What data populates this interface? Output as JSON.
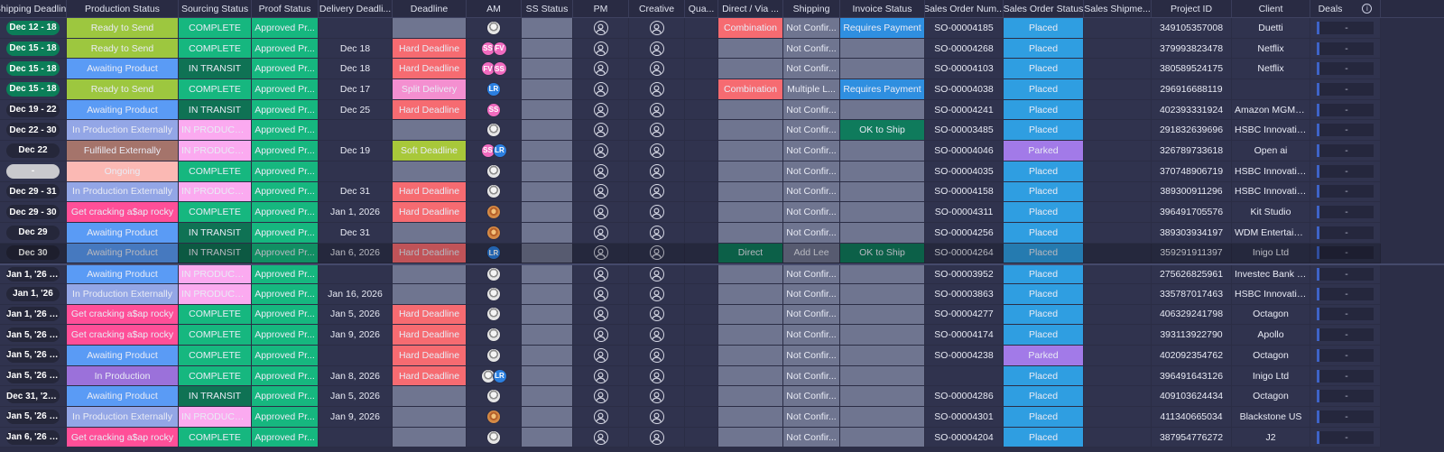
{
  "columns": [
    {
      "key": "ship",
      "label": "Shipping Deadline",
      "w": 74
    },
    {
      "key": "prod",
      "label": "Production Status",
      "w": 124
    },
    {
      "key": "src",
      "label": "Sourcing Status",
      "w": 81
    },
    {
      "key": "proof",
      "label": "Proof Status",
      "w": 74
    },
    {
      "key": "deliv",
      "label": "Delivery Deadli...",
      "w": 82
    },
    {
      "key": "dead",
      "label": "Deadline",
      "w": 82
    },
    {
      "key": "am",
      "label": "AM",
      "w": 61
    },
    {
      "key": "ss",
      "label": "SS Status",
      "w": 57
    },
    {
      "key": "pm",
      "label": "PM",
      "w": 62
    },
    {
      "key": "creative",
      "label": "Creative",
      "w": 62
    },
    {
      "key": "qua",
      "label": "Qua...",
      "w": 37
    },
    {
      "key": "direct",
      "label": "Direct / Via ...",
      "w": 72
    },
    {
      "key": "shipping",
      "label": "Shipping",
      "w": 63
    },
    {
      "key": "invoice",
      "label": "Invoice Status",
      "w": 94
    },
    {
      "key": "so",
      "label": "Sales Order Num...",
      "w": 87
    },
    {
      "key": "sos",
      "label": "Sales Order Status",
      "w": 89
    },
    {
      "key": "sship",
      "label": "Sales Shipme...",
      "w": 75
    },
    {
      "key": "proj",
      "label": "Project ID",
      "w": 89
    },
    {
      "key": "client",
      "label": "Client",
      "w": 87
    },
    {
      "key": "deals",
      "label": "Deals",
      "w": 78
    }
  ],
  "colors": {
    "ready": "#9dc73f",
    "awaiting": "#5a9bf5",
    "inprodext": "#93a6e6",
    "fulfilled": "#a5746b",
    "ongoing": "#fbb9b4",
    "getcracking": "#ff4f98",
    "inprod": "#9b71da",
    "complete": "#16b77f",
    "transit": "#0f7254",
    "inproduct": "#fbaaf0",
    "approved": "#16b77f",
    "hard": "#f66b71",
    "split": "#f48fd0",
    "soft": "#a8c83a",
    "combination": "#f66b71",
    "requires": "#2f8fe0",
    "okship": "#0f7b5c",
    "placed": "#2f9ee1",
    "parked": "#a27ae8",
    "direct": "#0f7b5c",
    "addlee": "#6f7590",
    "ss": "#f06bbf",
    "fv": "#f06bbf",
    "lr": "#2b7fe0"
  },
  "rows": [
    {
      "ship": "Dec 12 - 18",
      "shipStyle": "green",
      "prod": "Ready to Send",
      "prodC": "ready",
      "src": "COMPLETE",
      "srcC": "complete",
      "proof": "Approved Pr...",
      "deliv": "",
      "dead": "",
      "am": [
        "photo"
      ],
      "direct": "Combination",
      "directC": "combination",
      "shipping": "Not Confir...",
      "invoice": "Requires Payment",
      "invoiceC": "requires",
      "so": "SO-00004185",
      "sos": "Placed",
      "sosC": "placed",
      "proj": "349105357008",
      "client": "Duetti",
      "deals": "-"
    },
    {
      "ship": "Dec 15 - 18",
      "shipStyle": "green",
      "prod": "Ready to Send",
      "prodC": "ready",
      "src": "COMPLETE",
      "srcC": "complete",
      "proof": "Approved Pr...",
      "deliv": "Dec 18",
      "dead": "Hard Deadline",
      "deadC": "hard",
      "am": [
        "SS",
        "FV"
      ],
      "direct": "",
      "shipping": "Not Confir...",
      "invoice": "",
      "so": "SO-00004268",
      "sos": "Placed",
      "sosC": "placed",
      "proj": "379993823478",
      "client": "Netflix",
      "deals": "-"
    },
    {
      "ship": "Dec 15 - 18",
      "shipStyle": "green",
      "prod": "Awaiting Product",
      "prodC": "awaiting",
      "src": "IN TRANSIT",
      "srcC": "transit",
      "proof": "Approved Pr...",
      "deliv": "Dec 18",
      "dead": "Hard Deadline",
      "deadC": "hard",
      "am": [
        "FV",
        "SS"
      ],
      "direct": "",
      "shipping": "Not Confir...",
      "invoice": "",
      "so": "SO-00004103",
      "sos": "Placed",
      "sosC": "placed",
      "proj": "380589524175",
      "client": "Netflix",
      "deals": "-"
    },
    {
      "ship": "Dec 15 - 18",
      "shipStyle": "green",
      "prod": "Ready to Send",
      "prodC": "ready",
      "src": "COMPLETE",
      "srcC": "complete",
      "proof": "Approved Pr...",
      "deliv": "Dec 17",
      "dead": "Split Delivery",
      "deadC": "split",
      "am": [
        "LR"
      ],
      "direct": "Combination",
      "directC": "combination",
      "shipping": "Multiple L...",
      "invoice": "Requires Payment",
      "invoiceC": "requires",
      "so": "SO-00004038",
      "sos": "Placed",
      "sosC": "placed",
      "proj": "296916688119",
      "client": "",
      "deals": "-"
    },
    {
      "ship": "Dec 19 - 22",
      "shipStyle": "dark",
      "prod": "Awaiting Product",
      "prodC": "awaiting",
      "src": "IN TRANSIT",
      "srcC": "transit",
      "proof": "Approved Pr...",
      "deliv": "Dec 25",
      "dead": "Hard Deadline",
      "deadC": "hard",
      "am": [
        "SS"
      ],
      "direct": "",
      "shipping": "Not Confir...",
      "invoice": "",
      "so": "SO-00004241",
      "sos": "Placed",
      "sosC": "placed",
      "proj": "402393331924",
      "client": "Amazon MGM Stu...",
      "deals": "-"
    },
    {
      "ship": "Dec 22 - 30",
      "shipStyle": "dark",
      "prod": "In Production Externally",
      "prodC": "inprodext",
      "src": "IN PRODUCTI...",
      "srcC": "inproduct",
      "proof": "Approved Pr...",
      "deliv": "",
      "dead": "",
      "am": [
        "photo"
      ],
      "direct": "",
      "shipping": "Not Confir...",
      "invoice": "OK to Ship",
      "invoiceC": "okship",
      "so": "SO-00003485",
      "sos": "Placed",
      "sosC": "placed",
      "proj": "291832639696",
      "client": "HSBC Innovation ...",
      "deals": "-"
    },
    {
      "ship": "Dec 22",
      "shipStyle": "dark",
      "prod": "Fulfilled Externally",
      "prodC": "fulfilled",
      "src": "IN PRODUCTI...",
      "srcC": "inproduct",
      "proof": "Approved Pr...",
      "deliv": "Dec 19",
      "dead": "Soft Deadline",
      "deadC": "soft",
      "am": [
        "SS",
        "LR"
      ],
      "direct": "",
      "shipping": "Not Confir...",
      "invoice": "",
      "so": "SO-00004046",
      "sos": "Parked",
      "sosC": "parked",
      "proj": "326789733618",
      "client": "Open ai",
      "deals": "-"
    },
    {
      "ship": "-",
      "shipStyle": "grey",
      "prod": "Ongoing",
      "prodC": "ongoing",
      "src": "COMPLETE",
      "srcC": "complete",
      "proof": "Approved Pr...",
      "deliv": "",
      "dead": "",
      "am": [
        "photo"
      ],
      "direct": "",
      "shipping": "Not Confir...",
      "invoice": "",
      "so": "SO-00004035",
      "sos": "Placed",
      "sosC": "placed",
      "proj": "370748906719",
      "client": "HSBC Innovation ...",
      "deals": "-"
    },
    {
      "ship": "Dec 29 - 31",
      "shipStyle": "dark",
      "prod": "In Production Externally",
      "prodC": "inprodext",
      "src": "IN PRODUCTI...",
      "srcC": "inproduct",
      "proof": "Approved Pr...",
      "deliv": "Dec 31",
      "dead": "Hard Deadline",
      "deadC": "hard",
      "am": [
        "photo"
      ],
      "direct": "",
      "shipping": "Not Confir...",
      "invoice": "",
      "so": "SO-00004158",
      "sos": "Placed",
      "sosC": "placed",
      "proj": "389300911296",
      "client": "HSBC Innovation ...",
      "deals": "-"
    },
    {
      "ship": "Dec 29 - 30",
      "shipStyle": "dark",
      "prod": "Get cracking a$ap rocky",
      "prodC": "getcracking",
      "src": "COMPLETE",
      "srcC": "complete",
      "proof": "Approved Pr...",
      "deliv": "Jan 1, 2026",
      "dead": "Hard Deadline",
      "deadC": "hard",
      "am": [
        "photo2"
      ],
      "direct": "",
      "shipping": "Not Confir...",
      "invoice": "",
      "so": "SO-00004311",
      "sos": "Placed",
      "sosC": "placed",
      "proj": "396491705576",
      "client": "Kit Studio",
      "deals": "-"
    },
    {
      "ship": "Dec 29",
      "shipStyle": "dark",
      "prod": "Awaiting Product",
      "prodC": "awaiting",
      "src": "IN TRANSIT",
      "srcC": "transit",
      "proof": "Approved Pr...",
      "deliv": "Dec 31",
      "dead": "",
      "am": [
        "photo2"
      ],
      "direct": "",
      "shipping": "Not Confir...",
      "invoice": "",
      "so": "SO-00004256",
      "sos": "Placed",
      "sosC": "placed",
      "proj": "389303934197",
      "client": "WDM Entertainm...",
      "deals": "-"
    },
    {
      "ship": "Dec 30",
      "shipStyle": "dark",
      "dim": true,
      "prod": "Awaiting Product",
      "prodC": "awaiting",
      "src": "IN TRANSIT",
      "srcC": "transit",
      "proof": "Approved Pr...",
      "deliv": "Jan 6, 2026",
      "dead": "Hard Deadline",
      "deadC": "hard",
      "am": [
        "LR"
      ],
      "direct": "Direct",
      "directC": "direct",
      "shipping": "Add Lee",
      "shippingC": "addlee",
      "invoice": "OK to Ship",
      "invoiceC": "okship",
      "so": "SO-00004264",
      "sos": "Placed",
      "sosC": "placed",
      "proj": "359291911397",
      "client": "Inigo Ltd",
      "deals": "-"
    },
    {
      "ship": "Jan 1, '26 - Jan ...",
      "shipStyle": "dark",
      "sep": true,
      "prod": "Awaiting Product",
      "prodC": "awaiting",
      "src": "IN PRODUCTI...",
      "srcC": "inproduct",
      "proof": "Approved Pr...",
      "deliv": "",
      "dead": "",
      "am": [
        "photo"
      ],
      "direct": "",
      "shipping": "Not Confir...",
      "invoice": "",
      "so": "SO-00003952",
      "sos": "Placed",
      "sosC": "placed",
      "proj": "275626825961",
      "client": "Investec Bank Plc",
      "deals": "-"
    },
    {
      "ship": "Jan 1, '26",
      "shipStyle": "dark",
      "prod": "In Production Externally",
      "prodC": "inprodext",
      "src": "IN PRODUCTI...",
      "srcC": "inproduct",
      "proof": "Approved Pr...",
      "deliv": "Jan 16, 2026",
      "dead": "",
      "am": [
        "photo"
      ],
      "direct": "",
      "shipping": "Not Confir...",
      "invoice": "",
      "so": "SO-00003863",
      "sos": "Placed",
      "sosC": "placed",
      "proj": "335787017463",
      "client": "HSBC Innovation ...",
      "deals": "-"
    },
    {
      "ship": "Jan 1, '26 - Jan ...",
      "shipStyle": "dark",
      "prod": "Get cracking a$ap rocky",
      "prodC": "getcracking",
      "src": "COMPLETE",
      "srcC": "complete",
      "proof": "Approved Pr...",
      "deliv": "Jan 5, 2026",
      "dead": "Hard Deadline",
      "deadC": "hard",
      "am": [
        "photo"
      ],
      "direct": "",
      "shipping": "Not Confir...",
      "invoice": "",
      "so": "SO-00004277",
      "sos": "Placed",
      "sosC": "placed",
      "proj": "406329241798",
      "client": "Octagon",
      "deals": "-"
    },
    {
      "ship": "Jan 5, '26 - Jan ...",
      "shipStyle": "dark",
      "prod": "Get cracking a$ap rocky",
      "prodC": "getcracking",
      "src": "COMPLETE",
      "srcC": "complete",
      "proof": "Approved Pr...",
      "deliv": "Jan 9, 2026",
      "dead": "Hard Deadline",
      "deadC": "hard",
      "am": [
        "photo"
      ],
      "direct": "",
      "shipping": "Not Confir...",
      "invoice": "",
      "so": "SO-00004174",
      "sos": "Placed",
      "sosC": "placed",
      "proj": "393113922790",
      "client": "Apollo",
      "deals": "-"
    },
    {
      "ship": "Jan 5, '26 - Jan ...",
      "shipStyle": "dark",
      "prod": "Awaiting Product",
      "prodC": "awaiting",
      "src": "COMPLETE",
      "srcC": "complete",
      "proof": "Approved Pr...",
      "deliv": "",
      "dead": "Hard Deadline",
      "deadC": "hard",
      "am": [
        "photo"
      ],
      "direct": "",
      "shipping": "Not Confir...",
      "invoice": "",
      "so": "SO-00004238",
      "sos": "Parked",
      "sosC": "parked",
      "proj": "402092354762",
      "client": "Octagon",
      "deals": "-"
    },
    {
      "ship": "Jan 5, '26 - Jan ...",
      "shipStyle": "dark",
      "prod": "In Production",
      "prodC": "inprod",
      "src": "COMPLETE",
      "srcC": "complete",
      "proof": "Approved Pr...",
      "deliv": "Jan 8, 2026",
      "dead": "Hard Deadline",
      "deadC": "hard",
      "am": [
        "photo",
        "LR"
      ],
      "direct": "",
      "shipping": "Not Confir...",
      "invoice": "",
      "so": "",
      "sos": "Placed",
      "sosC": "placed",
      "proj": "396491643126",
      "client": "Inigo Ltd",
      "deals": "-"
    },
    {
      "ship": "Dec 31, '25 - Ja...",
      "shipStyle": "dark",
      "prod": "Awaiting Product",
      "prodC": "awaiting",
      "src": "IN TRANSIT",
      "srcC": "transit",
      "proof": "Approved Pr...",
      "deliv": "Jan 5, 2026",
      "dead": "",
      "am": [
        "photo"
      ],
      "direct": "",
      "shipping": "Not Confir...",
      "invoice": "",
      "so": "SO-00004286",
      "sos": "Placed",
      "sosC": "placed",
      "proj": "409103624434",
      "client": "Octagon",
      "deals": "-"
    },
    {
      "ship": "Jan 5, '26 - Jan ...",
      "shipStyle": "dark",
      "prod": "In Production Externally",
      "prodC": "inprodext",
      "src": "IN PRODUCTI...",
      "srcC": "inproduct",
      "proof": "Approved Pr...",
      "deliv": "Jan 9, 2026",
      "dead": "",
      "am": [
        "photo2"
      ],
      "direct": "",
      "shipping": "Not Confir...",
      "invoice": "",
      "so": "SO-00004301",
      "sos": "Placed",
      "sosC": "placed",
      "proj": "411340665034",
      "client": "Blackstone US",
      "deals": "-"
    },
    {
      "ship": "Jan 6, '26 - Jan ...",
      "shipStyle": "dark",
      "prod": "Get cracking a$ap rocky",
      "prodC": "getcracking",
      "src": "COMPLETE",
      "srcC": "complete",
      "proof": "Approved Pr...",
      "deliv": "",
      "dead": "",
      "am": [
        "photo"
      ],
      "direct": "",
      "shipping": "Not Confir...",
      "invoice": "",
      "so": "SO-00004204",
      "sos": "Placed",
      "sosC": "placed",
      "proj": "387954776272",
      "client": "J2",
      "deals": "-"
    }
  ]
}
